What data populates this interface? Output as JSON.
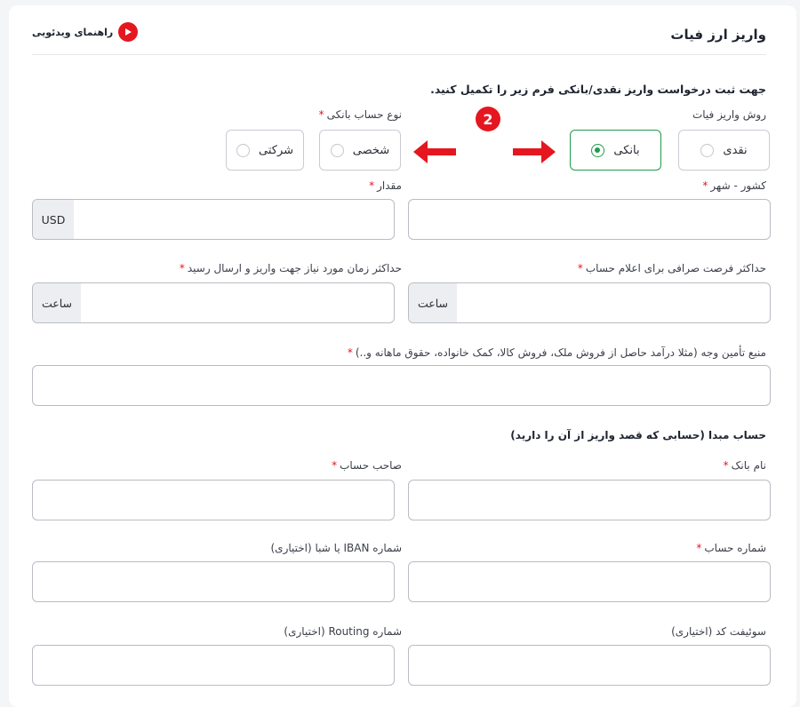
{
  "header": {
    "title": "واریز ارز فیات",
    "video_guide_label": "راهنمای ویدئویی"
  },
  "intro_text": "جهت ثبت درخواست واریز نقدی/بانکی فرم زیر را تکمیل کنید.",
  "deposit_method": {
    "label": "روش واریز فیات",
    "options": [
      "نقدی",
      "بانکی"
    ],
    "selected": "بانکی"
  },
  "account_type": {
    "label": "نوع حساب بانکی",
    "options": [
      "شخصی",
      "شرکتی"
    ]
  },
  "annotation": {
    "step_number": "2",
    "color": "#e5161f"
  },
  "fields": {
    "country_city": {
      "label": "کشور - شهر",
      "value": ""
    },
    "amount": {
      "label": "مقدار",
      "addon": "USD",
      "value": ""
    },
    "max_exchange_time": {
      "label": "حداکثر فرصت صرافی برای اعلام حساب",
      "addon": "ساعت",
      "value": ""
    },
    "max_deposit_time": {
      "label": "حداکثر زمان مورد نیاز جهت واریز و ارسال رسید",
      "addon": "ساعت",
      "value": ""
    },
    "funding_source": {
      "label": "منبع تأمین وجه (مثلا درآمد حاصل از فروش ملک، فروش کالا، کمک خانواده، حقوق ماهانه و..)",
      "value": ""
    },
    "bank_name": {
      "label": "نام بانک",
      "value": ""
    },
    "account_holder": {
      "label": "صاحب حساب",
      "value": ""
    },
    "account_number": {
      "label": "شماره حساب",
      "value": ""
    },
    "iban": {
      "label": "شماره IBAN یا شبا (اختیاری)",
      "value": ""
    },
    "swift": {
      "label": "سوئیفت کد (اختیاری)",
      "value": ""
    },
    "routing": {
      "label": "شماره Routing (اختیاری)",
      "value": ""
    }
  },
  "source_account_heading": "حساب مبدا (حسابی که قصد واریز از آن را دارید)",
  "colors": {
    "accent_green": "#1f9d4d",
    "required_red": "#e5161f",
    "youtube_red": "#e5161f"
  }
}
